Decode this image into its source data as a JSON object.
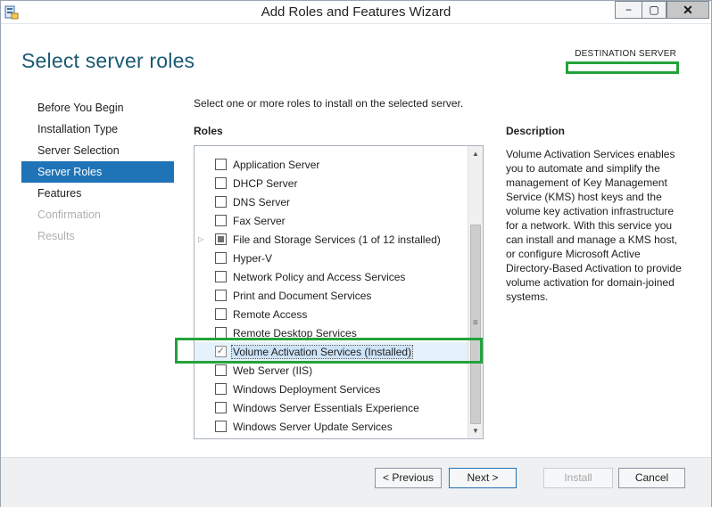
{
  "window": {
    "title": "Add Roles and Features Wizard",
    "icon": "server-manager-icon",
    "controls": {
      "minimize": "−",
      "maximize": "▢",
      "close": "✕"
    }
  },
  "header": {
    "page_title": "Select server roles",
    "destination_label": "DESTINATION SERVER"
  },
  "nav": {
    "items": [
      {
        "label": "Before You Begin",
        "state": "normal"
      },
      {
        "label": "Installation Type",
        "state": "normal"
      },
      {
        "label": "Server Selection",
        "state": "normal"
      },
      {
        "label": "Server Roles",
        "state": "active"
      },
      {
        "label": "Features",
        "state": "normal"
      },
      {
        "label": "Confirmation",
        "state": "disabled"
      },
      {
        "label": "Results",
        "state": "disabled"
      }
    ]
  },
  "main": {
    "instruction": "Select one or more roles to install on the selected server.",
    "roles_label": "Roles",
    "roles": [
      {
        "label": "Application Server",
        "state": "unchecked"
      },
      {
        "label": "DHCP Server",
        "state": "unchecked"
      },
      {
        "label": "DNS Server",
        "state": "unchecked"
      },
      {
        "label": "Fax Server",
        "state": "unchecked"
      },
      {
        "label": "File and Storage Services (1 of 12 installed)",
        "state": "partial",
        "expandable": true
      },
      {
        "label": "Hyper-V",
        "state": "unchecked"
      },
      {
        "label": "Network Policy and Access Services",
        "state": "unchecked"
      },
      {
        "label": "Print and Document Services",
        "state": "unchecked"
      },
      {
        "label": "Remote Access",
        "state": "unchecked"
      },
      {
        "label": "Remote Desktop Services",
        "state": "unchecked"
      },
      {
        "label": "Volume Activation Services (Installed)",
        "state": "checked-disabled",
        "selected": true
      },
      {
        "label": "Web Server (IIS)",
        "state": "unchecked"
      },
      {
        "label": "Windows Deployment Services",
        "state": "unchecked"
      },
      {
        "label": "Windows Server Essentials Experience",
        "state": "unchecked"
      },
      {
        "label": "Windows Server Update Services",
        "state": "unchecked"
      }
    ],
    "description_label": "Description",
    "description_text": "Volume Activation Services enables you to automate and simplify the management of Key Management Service (KMS) host keys and the volume key activation infrastructure for a network. With this service you can install and manage a KMS host, or configure Microsoft Active Directory-Based Activation to provide volume activation for domain-joined systems."
  },
  "footer": {
    "previous": "< Previous",
    "next": "Next >",
    "install": "Install",
    "cancel": "Cancel"
  },
  "colors": {
    "accent": "#1f73b7",
    "title": "#1a5a73",
    "highlight_annotation": "#23a33a"
  }
}
